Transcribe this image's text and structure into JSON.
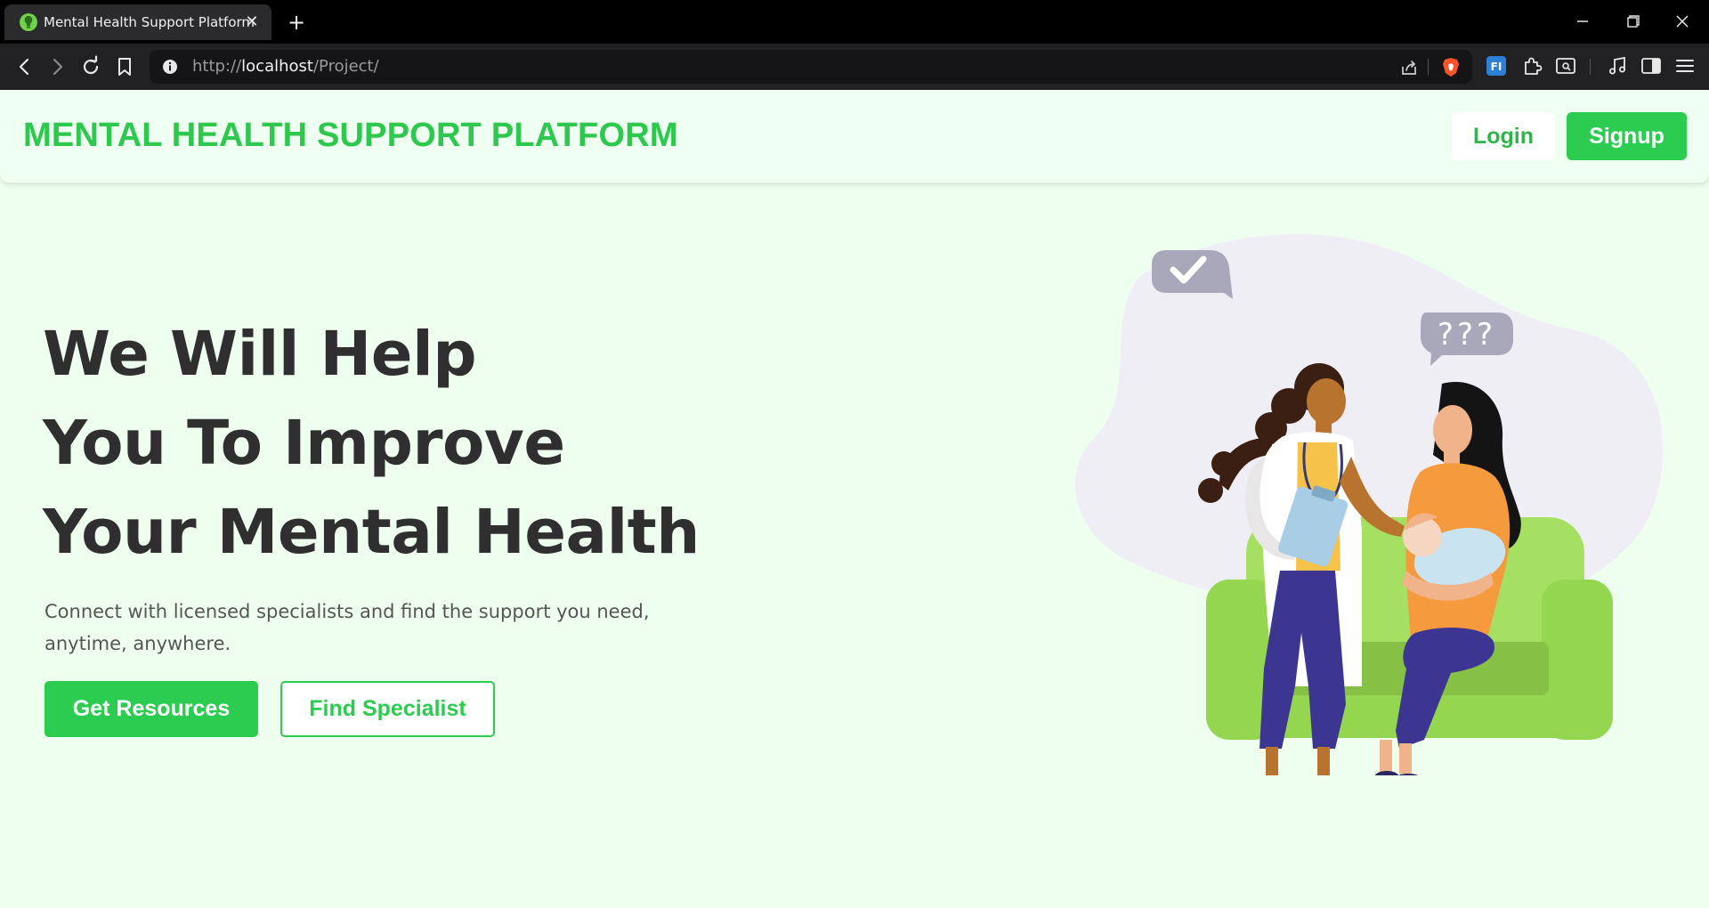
{
  "browser": {
    "tab_title": "Mental Health Support Platform",
    "url_scheme": "http://",
    "url_host": "localhost",
    "url_path": "/Project/"
  },
  "nav": {
    "brand": "MENTAL HEALTH SUPPORT PLATFORM",
    "login_label": "Login",
    "signup_label": "Signup"
  },
  "hero": {
    "title_line1": "We Will Help",
    "title_line2": "You To Improve",
    "title_line3": "Your Mental Health",
    "subtitle": "Connect with licensed specialists and find the support you need, anytime, anywhere.",
    "primary_button": "Get Resources",
    "secondary_button": "Find Specialist",
    "bubble_question_text": "???"
  },
  "colors": {
    "accent": "#2ccc50",
    "page_background": "#efffef",
    "heading": "#2f2f2f"
  }
}
